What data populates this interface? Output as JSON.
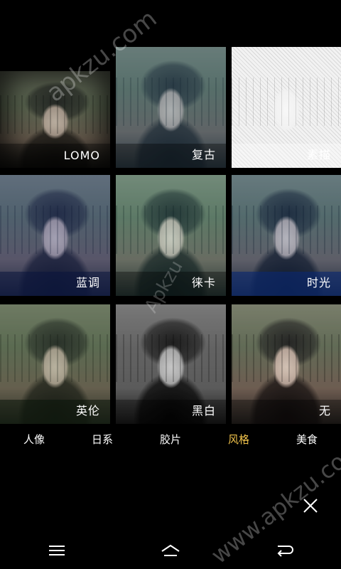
{
  "filters": [
    {
      "label": "LOMO"
    },
    {
      "label": "复古"
    },
    {
      "label": "素描"
    },
    {
      "label": "蓝调"
    },
    {
      "label": "徕卡"
    },
    {
      "label": "时光"
    },
    {
      "label": "英伦"
    },
    {
      "label": "黑白"
    },
    {
      "label": "无"
    }
  ],
  "tabs": [
    {
      "label": "人像"
    },
    {
      "label": "日系"
    },
    {
      "label": "胶片"
    },
    {
      "label": "风格"
    },
    {
      "label": "美食"
    }
  ],
  "selected_tab": "风格",
  "watermarks": [
    "apkzu.com",
    "Apkzu",
    "www.apkzu.com"
  ],
  "colors": {
    "active_tab": "#f0c24b",
    "background": "#000000"
  },
  "icons": {
    "close": "close-icon",
    "menu": "menu-icon",
    "home": "home-icon",
    "back": "back-icon"
  }
}
